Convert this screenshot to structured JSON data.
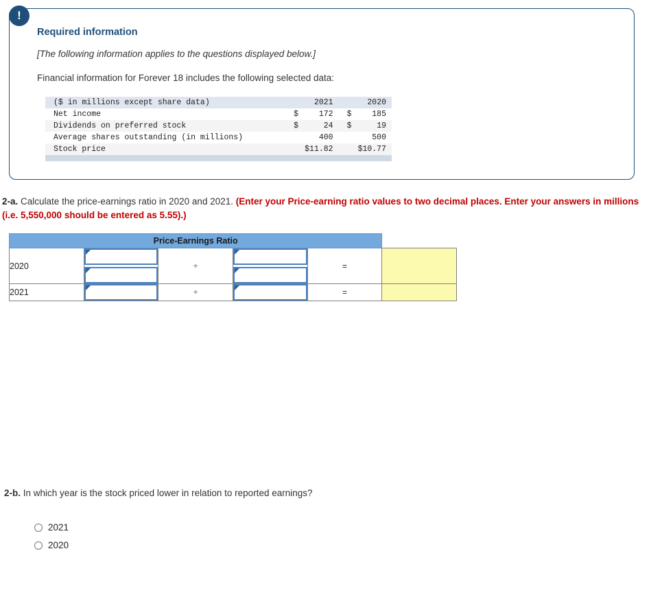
{
  "panel": {
    "alert_icon": "exclamation-icon",
    "alert_glyph": "!",
    "title": "Required information",
    "italic_note": "[The following information applies to the questions displayed below.]",
    "intro": "Financial information for Forever 18 includes the following selected data:"
  },
  "financial_table": {
    "col_label": "($ in millions except share data)",
    "col_year1": "2021",
    "col_year2": "2020",
    "rows": [
      {
        "label": "Net income",
        "y1_cur": "$",
        "y1_val": "172",
        "y2_cur": "$",
        "y2_val": "185"
      },
      {
        "label": "Dividends on preferred stock",
        "y1_cur": "$",
        "y1_val": "24",
        "y2_cur": "$",
        "y2_val": "19"
      },
      {
        "label": "Average shares outstanding (in millions)",
        "y1_cur": "",
        "y1_val": "400",
        "y2_cur": "",
        "y2_val": "500"
      },
      {
        "label": "Stock price",
        "y1_cur": "",
        "y1_val": "$11.82",
        "y2_cur": "",
        "y2_val": "$10.77"
      }
    ]
  },
  "q2a": {
    "number": "2-a.",
    "text": "Calculate the price-earnings ratio in 2020 and 2021.",
    "red_text": "(Enter your Price-earning ratio values to two decimal places. Enter your answers in millions (i.e. 5,550,000 should be entered as 5.55).)"
  },
  "answer_table": {
    "header": "Price-Earnings Ratio",
    "divide_symbol": "÷",
    "equals_symbol": "=",
    "rows": [
      {
        "year": "2020",
        "numerator_fields": [
          "",
          ""
        ],
        "denominator_fields": [
          "",
          ""
        ],
        "result": ""
      },
      {
        "year": "2021",
        "numerator_fields": [
          ""
        ],
        "denominator_fields": [
          ""
        ],
        "result": ""
      }
    ]
  },
  "q2b": {
    "number": "2-b.",
    "text": "In which year is the stock priced lower in relation to reported earnings?",
    "options": [
      {
        "label": "2021",
        "selected": false
      },
      {
        "label": "2020",
        "selected": false
      }
    ]
  },
  "colors": {
    "panel_border": "#1f4e79",
    "badge": "#1f4e79",
    "heading": "#1f4e79",
    "red": "#c00000",
    "table_header_blue": "#74a9dd",
    "answer_yellow": "#fcfaaf",
    "input_border": "#4a81bf"
  }
}
